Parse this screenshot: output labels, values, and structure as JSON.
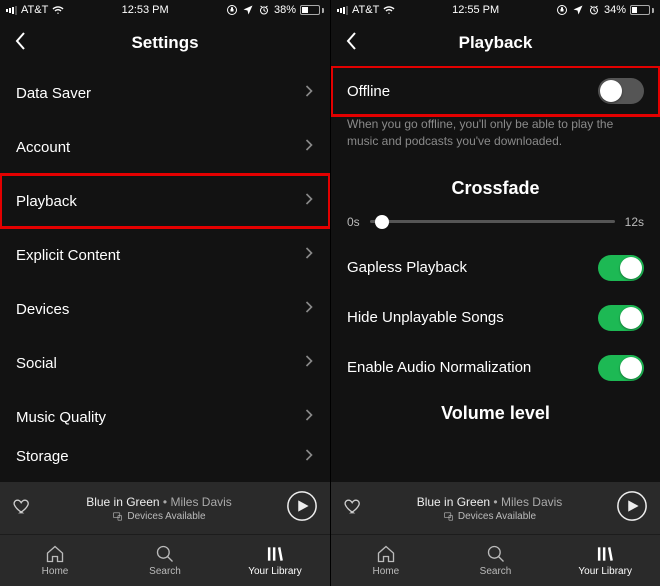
{
  "left": {
    "status": {
      "carrier": "AT&T",
      "time": "12:53 PM",
      "battery_pct": "38%",
      "battery_fill": 0.38
    },
    "header_title": "Settings",
    "items": [
      {
        "label": "Data Saver",
        "highlight": false
      },
      {
        "label": "Account",
        "highlight": false
      },
      {
        "label": "Playback",
        "highlight": true
      },
      {
        "label": "Explicit Content",
        "highlight": false
      },
      {
        "label": "Devices",
        "highlight": false
      },
      {
        "label": "Social",
        "highlight": false
      },
      {
        "label": "Music Quality",
        "highlight": false
      },
      {
        "label": "Storage",
        "highlight": false
      }
    ]
  },
  "right": {
    "status": {
      "carrier": "AT&T",
      "time": "12:55 PM",
      "battery_pct": "34%",
      "battery_fill": 0.34
    },
    "header_title": "Playback",
    "offline": {
      "label": "Offline",
      "on": false,
      "highlight": true
    },
    "offline_help": "When you go offline, you'll only be able to play the music and podcasts you've downloaded.",
    "crossfade_title": "Crossfade",
    "crossfade": {
      "min_label": "0s",
      "max_label": "12s",
      "position": 0.05
    },
    "toggles": [
      {
        "label": "Gapless Playback",
        "on": true
      },
      {
        "label": "Hide Unplayable Songs",
        "on": true
      },
      {
        "label": "Enable Audio Normalization",
        "on": true
      }
    ],
    "volume_title": "Volume level"
  },
  "now_playing": {
    "track": "Blue in Green",
    "separator": " • ",
    "artist": "Miles Davis",
    "devices_label": "Devices Available"
  },
  "tabs": {
    "home": "Home",
    "search": "Search",
    "library": "Your Library"
  }
}
